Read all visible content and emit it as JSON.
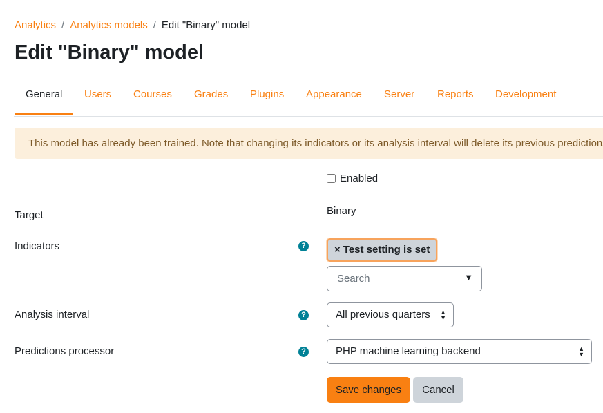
{
  "breadcrumb": {
    "items": [
      "Analytics",
      "Analytics models"
    ],
    "separator": "/",
    "current": "Edit \"Binary\" model"
  },
  "page_title": "Edit \"Binary\" model",
  "tabs": [
    "General",
    "Users",
    "Courses",
    "Grades",
    "Plugins",
    "Appearance",
    "Server",
    "Reports",
    "Development"
  ],
  "active_tab": "General",
  "alert": "This model has already been trained. Note that changing its indicators or its analysis interval will delete its previous predictions.",
  "form": {
    "enabled_label": "Enabled",
    "enabled_checked": false,
    "target_label": "Target",
    "target_value": "Binary",
    "indicators_label": "Indicators",
    "indicator_tag": "Test setting is set",
    "tag_remove": "×",
    "search_placeholder": "Search",
    "search_arrow": "▼",
    "analysis_interval_label": "Analysis interval",
    "analysis_interval_value": "All previous quarters",
    "predictions_processor_label": "Predictions processor",
    "predictions_processor_value": "PHP machine learning backend",
    "help_glyph": "?",
    "select_up": "▲",
    "select_down": "▼"
  },
  "buttons": {
    "save": "Save changes",
    "cancel": "Cancel"
  },
  "colors": {
    "accent": "#f98012",
    "help_icon": "#008196",
    "alert_bg": "#fcefdc",
    "alert_text": "#7d5a29",
    "secondary_button": "#ced4da"
  }
}
